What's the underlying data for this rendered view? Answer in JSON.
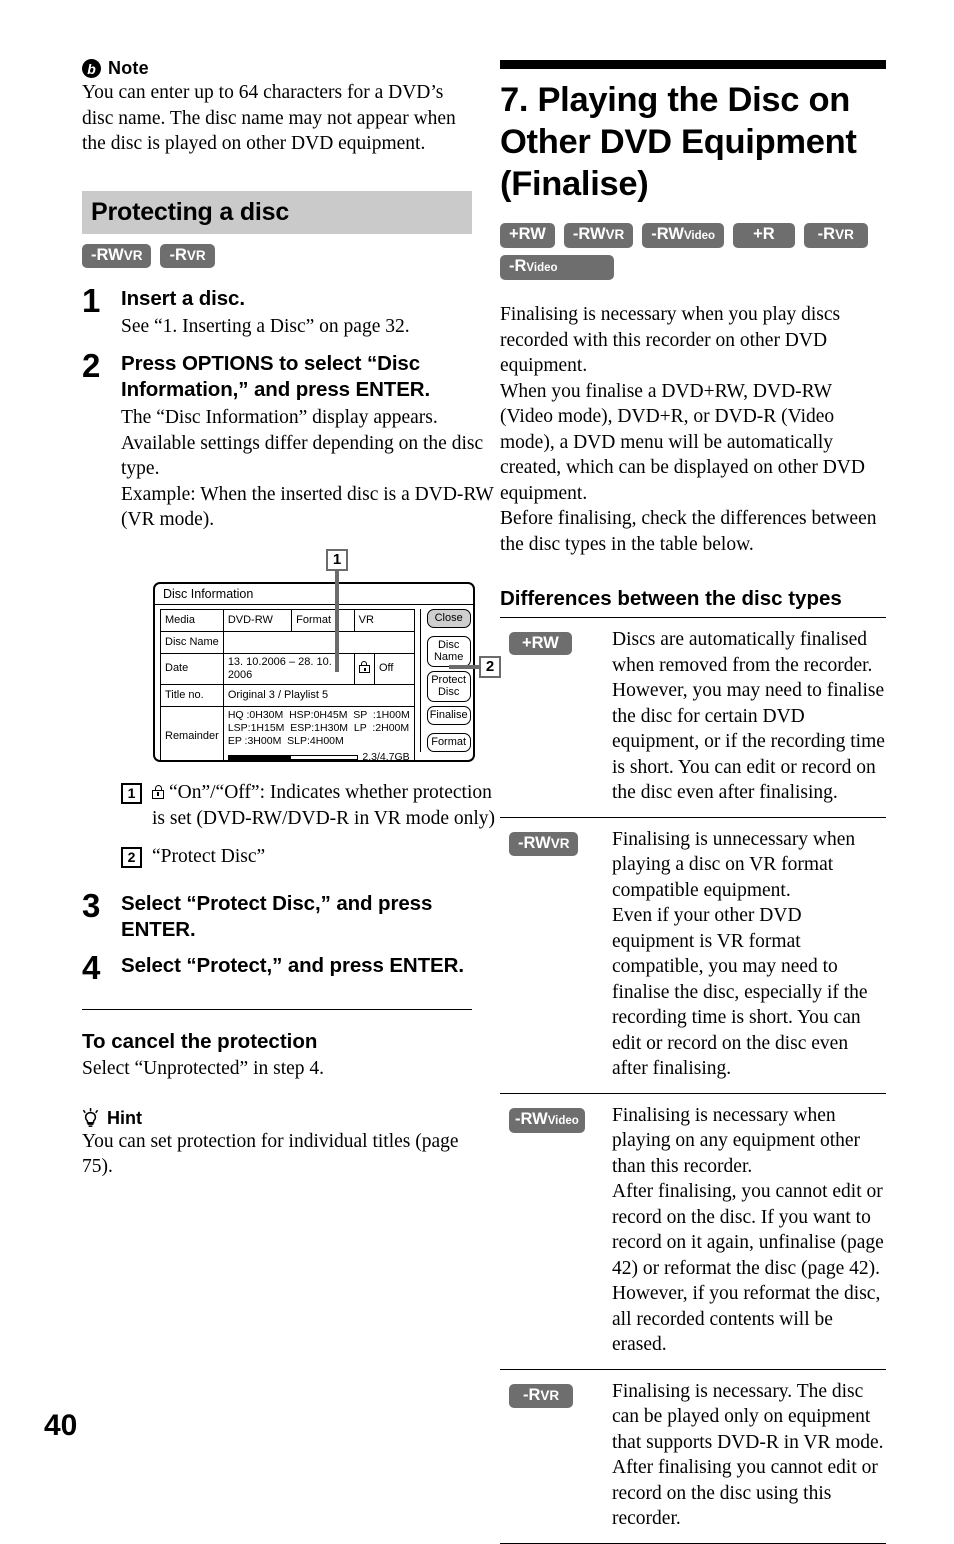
{
  "page": {
    "number": "40"
  },
  "left_column": {
    "note": {
      "icon": "note-bolt-icon",
      "label": "Note",
      "body": "You can enter up to 64 characters for a DVD’s disc name. The disc name may not appear when the disc is played on other DVD equipment."
    },
    "section": {
      "title": "Protecting a disc",
      "badges": [
        {
          "main": "-RW",
          "sub": "VR",
          "sub_style": "caps"
        },
        {
          "main": "-R",
          "sub": "VR",
          "sub_style": "caps"
        }
      ]
    },
    "steps": [
      {
        "num": "1",
        "title": "Insert a disc.",
        "text": "See “1. Inserting a Disc” on page 32."
      },
      {
        "num": "2",
        "title": "Press OPTIONS to select “Disc Information,” and press ENTER.",
        "text": "The “Disc Information” display appears. Available settings differ depending on the disc type.\nExample: When the inserted disc is a DVD-RW (VR mode)."
      },
      {
        "num": "3",
        "title": "Select “Protect Disc,” and press ENTER.",
        "text": ""
      },
      {
        "num": "4",
        "title": "Select “Protect,” and press ENTER.",
        "text": ""
      }
    ],
    "figure": {
      "callout_1": "1",
      "callout_2": "2",
      "screen_title": "Disc Information",
      "rows": {
        "media_label": "Media",
        "media_value": "DVD-RW",
        "format_label": "Format",
        "format_value": "VR",
        "disc_name_label": "Disc Name",
        "disc_name_value": "",
        "date_label": "Date",
        "date_value": "13. 10.2006 – 28. 10. 2006",
        "protect_value": "Off",
        "title_no_label": "Title no.",
        "title_no_value": "Original   3 / Playlist 5",
        "remainder_label": "Remainder",
        "remainder_line1": "HQ :0H30M  HSP:0H45M  SP  :1H00M",
        "remainder_line2": "LSP:1H15M  ESP:1H30M  LP  :2H00M",
        "remainder_line3": "EP :3H00M  SLP:4H00M",
        "capacity": "2.3/4.7GB",
        "capacity_percent": 48
      },
      "buttons": [
        {
          "label": "Close",
          "selected": true
        },
        {
          "label": "Disc Name",
          "selected": false
        },
        {
          "label": "Protect Disc",
          "selected": false
        },
        {
          "label": "Finalise",
          "selected": false
        },
        {
          "label": "Format",
          "selected": false
        }
      ]
    },
    "callouts": [
      {
        "marker": "1",
        "icon": "lock-icon",
        "text": "“On”/“Off”: Indicates whether protection is set (DVD-RW/DVD-R in VR mode only)"
      },
      {
        "marker": "2",
        "icon": "",
        "text": "“Protect Disc”"
      }
    ],
    "cancel": {
      "heading": "To cancel the protection",
      "text": "Select “Unprotected” in step 4."
    },
    "hint": {
      "icon": "lightbulb-icon",
      "label": "Hint",
      "text": "You can set protection for individual titles (page 75)."
    }
  },
  "right_column": {
    "chapter_title": "7. Playing the Disc on Other DVD Equipment (Finalise)",
    "badges": [
      {
        "main": "+RW",
        "sub": "",
        "sub_style": ""
      },
      {
        "main": "-RW",
        "sub": "VR",
        "sub_style": "caps"
      },
      {
        "main": "-RW",
        "sub": "Video",
        "sub_style": "mixed"
      },
      {
        "main": "+R",
        "sub": "",
        "sub_style": ""
      },
      {
        "main": "-R",
        "sub": "VR",
        "sub_style": "caps"
      },
      {
        "main": "-R",
        "sub": "Video",
        "sub_style": "mixed"
      }
    ],
    "body": "Finalising is necessary when you play discs recorded with this recorder on other DVD equipment.\nWhen you finalise a DVD+RW, DVD-RW (Video mode), DVD+R, or DVD-R (Video mode), a DVD menu will be automatically created, which can be displayed on other DVD equipment.\nBefore finalising, check the differences between the disc types in the table below.",
    "differences": {
      "heading": "Differences between the disc types",
      "rows": [
        {
          "badge": {
            "main": "+RW",
            "sub": "",
            "sub_style": ""
          },
          "text": "Discs are automatically finalised when removed from the recorder. However, you may need to finalise the disc for certain DVD equipment, or if the recording time is short. You can edit or record on the disc even after finalising."
        },
        {
          "badge": {
            "main": "-RW",
            "sub": "VR",
            "sub_style": "caps"
          },
          "text": "Finalising is unnecessary when playing a disc on VR format compatible equipment.\nEven if your other DVD equipment is VR format compatible, you may need to finalise the disc, especially if the recording time is short. You can edit or record on the disc even after finalising."
        },
        {
          "badge": {
            "main": "-RW",
            "sub": "Video",
            "sub_style": "mixed"
          },
          "text": "Finalising is necessary when playing on any equipment other than this recorder.\nAfter finalising, you cannot edit or record on the disc. If you want to record on it again, unfinalise (page 42) or reformat the disc (page 42). However, if you reformat the disc, all recorded contents will be erased."
        },
        {
          "badge": {
            "main": "-R",
            "sub": "VR",
            "sub_style": "caps"
          },
          "text": "Finalising is necessary. The disc can be played only on equipment that supports DVD-R in VR mode. After finalising you cannot edit or record on the disc using this recorder."
        }
      ]
    }
  },
  "colors": {
    "badge_gray": "#6e6e6e",
    "band_gray": "#cacaca",
    "callout_gray": "#6b6b6b",
    "selected_button_gray": "#cfcfcf"
  }
}
